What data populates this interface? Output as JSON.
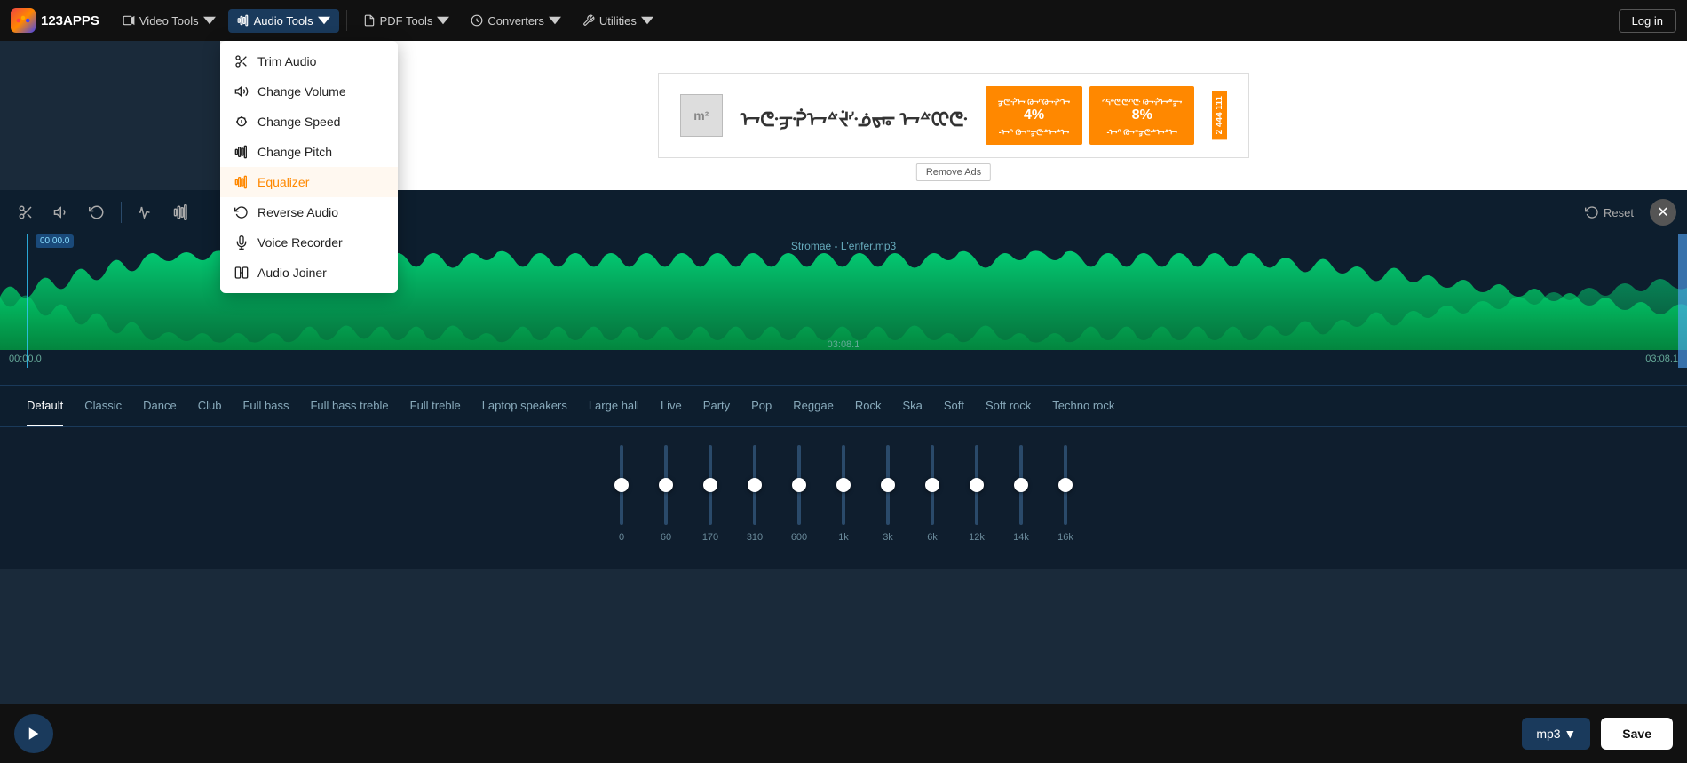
{
  "app": {
    "logo_text": "123APPS",
    "login_label": "Log in"
  },
  "nav": {
    "video_tools": "Video Tools",
    "audio_tools": "Audio Tools",
    "pdf_tools": "PDF Tools",
    "converters": "Converters",
    "utilities": "Utilities"
  },
  "dropdown": {
    "items": [
      {
        "id": "trim-audio",
        "label": "Trim Audio",
        "icon": "scissors"
      },
      {
        "id": "change-volume",
        "label": "Change Volume",
        "icon": "volume"
      },
      {
        "id": "change-speed",
        "label": "Change Speed",
        "icon": "speed"
      },
      {
        "id": "change-pitch",
        "label": "Change Pitch",
        "icon": "pitch"
      },
      {
        "id": "equalizer",
        "label": "Equalizer",
        "icon": "eq",
        "active": true
      },
      {
        "id": "reverse-audio",
        "label": "Reverse Audio",
        "icon": "reverse"
      },
      {
        "id": "voice-recorder",
        "label": "Voice Recorder",
        "icon": "mic"
      },
      {
        "id": "audio-joiner",
        "label": "Audio Joiner",
        "icon": "join"
      }
    ]
  },
  "waveform": {
    "track_name": "Stromae - L'enfer.mp3",
    "time_start": "00:00.0",
    "time_end": "03:08.1",
    "time_mid": "03:08.1",
    "playhead_time": "00:00.0",
    "reset_label": "Reset"
  },
  "eq": {
    "tabs": [
      {
        "id": "default",
        "label": "Default",
        "active": true
      },
      {
        "id": "classic",
        "label": "Classic"
      },
      {
        "id": "dance",
        "label": "Dance"
      },
      {
        "id": "club",
        "label": "Club"
      },
      {
        "id": "full-bass",
        "label": "Full bass"
      },
      {
        "id": "full-bass-treble",
        "label": "Full bass treble"
      },
      {
        "id": "full-treble",
        "label": "Full treble"
      },
      {
        "id": "laptop",
        "label": "Laptop speakers"
      },
      {
        "id": "large-hall",
        "label": "Large hall"
      },
      {
        "id": "live",
        "label": "Live"
      },
      {
        "id": "party",
        "label": "Party"
      },
      {
        "id": "pop",
        "label": "Pop"
      },
      {
        "id": "reggae",
        "label": "Reggae"
      },
      {
        "id": "rock",
        "label": "Rock"
      },
      {
        "id": "ska",
        "label": "Ska"
      },
      {
        "id": "soft",
        "label": "Soft"
      },
      {
        "id": "soft-rock",
        "label": "Soft rock"
      },
      {
        "id": "techno-rock",
        "label": "Techno rock"
      }
    ],
    "bands": [
      {
        "freq": "0",
        "position": 50
      },
      {
        "freq": "60",
        "position": 50
      },
      {
        "freq": "170",
        "position": 50
      },
      {
        "freq": "310",
        "position": 50
      },
      {
        "freq": "600",
        "position": 50
      },
      {
        "freq": "1k",
        "position": 50
      },
      {
        "freq": "3k",
        "position": 50
      },
      {
        "freq": "6k",
        "position": 50
      },
      {
        "freq": "12k",
        "position": 50
      },
      {
        "freq": "14k",
        "position": 50
      },
      {
        "freq": "16k",
        "position": 50
      }
    ]
  },
  "bottom": {
    "format_label": "mp3 ▼",
    "save_label": "Save"
  },
  "ad": {
    "remove_ads_label": "Remove Ads"
  }
}
